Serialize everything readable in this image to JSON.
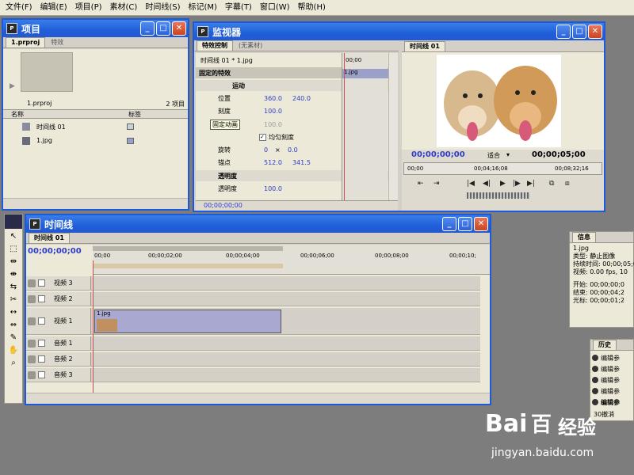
{
  "menu": [
    "文件(F)",
    "编辑(E)",
    "项目(P)",
    "素材(C)",
    "时间线(S)",
    "标记(M)",
    "字幕(T)",
    "窗口(W)",
    "帮助(H)"
  ],
  "project": {
    "title": "项目",
    "tabs": [
      "1.prproj",
      "特效"
    ],
    "filename": "1.prproj",
    "count": "2 项目",
    "col_name": "名称",
    "col_label": "标签",
    "items": [
      {
        "name": "时间线 01",
        "color": "#c8d0d8"
      },
      {
        "name": "1.jpg",
        "color": "#9aa0c8"
      }
    ]
  },
  "monitor": {
    "title": "监视器",
    "tabs": [
      "特效控制",
      "(无素材)"
    ],
    "seq_label": "时间线 01 * 1.jpg",
    "clip_tag": "1.jpg",
    "ruler_tc": "00;00",
    "fixed_fx": "固定的特效",
    "motion": "运动",
    "pos_label": "位置",
    "pos_x": "360.0",
    "pos_y": "240.0",
    "scale_label": "刻度",
    "scale_val": "100.0",
    "scale_w_label": "固定动画",
    "scale_w_val": "100.0",
    "uniform": "均匀刻度",
    "rot_label": "旋转",
    "rot_turns": "0",
    "rot_deg": "0.0",
    "anchor_label": "锚点",
    "anchor_x": "512.0",
    "anchor_y": "341.5",
    "opacity_fx": "透明度",
    "opacity_label": "透明度",
    "opacity_val": "100.0",
    "footer_tc": "00;00;00;00",
    "program_tab": "时间线 01",
    "prog_tc": "00;00;00;00",
    "fit": "适合",
    "duration": "00;00;05;00",
    "r1": "00;00",
    "r2": "00;04;16;08",
    "r3": "00;08;32;16"
  },
  "timeline": {
    "title": "时间线",
    "tab": "时间线 01",
    "tc": "00;00;00;00",
    "ruler": [
      "00;00",
      "00;00;02;00",
      "00;00;04;00",
      "00;00;06;00",
      "00;00;08;00",
      "00;00;10;"
    ],
    "tracks": [
      {
        "name": "视频 3"
      },
      {
        "name": "视频 2"
      },
      {
        "name": "视频 1"
      },
      {
        "name": "音频 1"
      },
      {
        "name": "音频 2"
      },
      {
        "name": "音频 3"
      }
    ],
    "clip": "1.jpg"
  },
  "info": {
    "tab": "信息",
    "file": "1.jpg",
    "type": "类型: 静止图像",
    "dur": "持续时间: 00;00;05;0",
    "video": "视频: 0.00 fps, 10",
    "start": "开始: 00;00;00;0",
    "end": "结束: 00;00;04;2",
    "cursor": "光标: 00;00;01;2"
  },
  "history": {
    "tab": "历史",
    "items": [
      "编辑参",
      "编辑参",
      "编辑参",
      "编辑参",
      "编辑参"
    ],
    "undo": "30撤消"
  },
  "watermark": {
    "brand": "Bai",
    "paw": "百",
    "tail": "经验",
    "url": "jingyan.baidu.com"
  }
}
